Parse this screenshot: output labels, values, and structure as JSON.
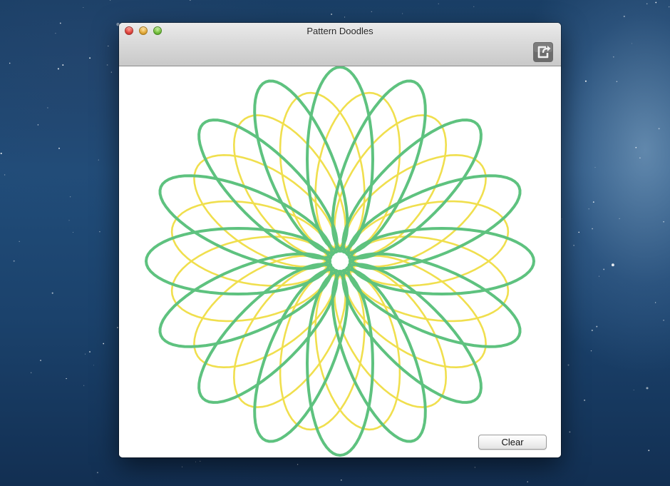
{
  "window": {
    "title": "Pattern Doodles"
  },
  "toolbar": {
    "share_icon": "share-icon"
  },
  "canvas": {
    "clear_label": "Clear",
    "pattern": {
      "green_petal_count": 16,
      "yellow_petal_count": 16
    }
  },
  "colors": {
    "green_stroke": "#5ec27f",
    "yellow_stroke": "#f0df4e"
  }
}
